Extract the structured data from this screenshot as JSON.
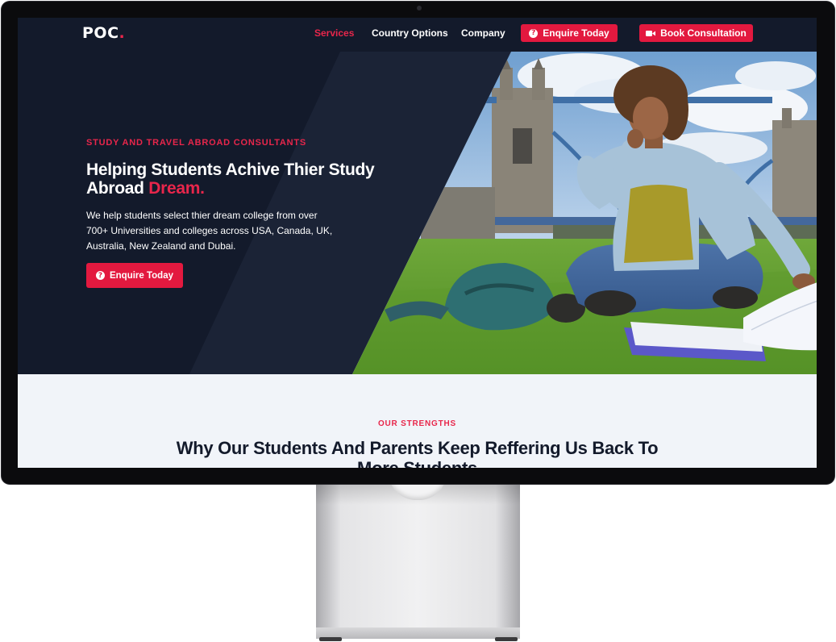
{
  "brand": {
    "name": "POC",
    "dot": "."
  },
  "nav": {
    "links": [
      "Services",
      "Country Options",
      "Company"
    ],
    "enquire_label": "Enquire Today",
    "consult_label": "Book Consultation"
  },
  "hero": {
    "eyebrow": "STUDY AND TRAVEL ABROAD CONSULTANTS",
    "title": "Helping Students Achive Thier Study Abroad",
    "title_accent": "Dream.",
    "description": "We help students select thier dream college from over 700+ Universities and colleges across USA, Canada, UK, Australia, New Zealand and Dubai.",
    "cta_label": "Enquire Today",
    "image_alt": "Student reading on grass in front of Tower Bridge"
  },
  "strengths": {
    "eyebrow": "OUR STRENGTHS",
    "title": "Why Our Students And Parents Keep Reffering Us Back To More Students"
  },
  "icons": {
    "question": "?",
    "video": "video-camera-icon"
  },
  "colors": {
    "navy": "#131a2b",
    "accent": "#e8264b",
    "section_bg": "#f1f4f9"
  }
}
